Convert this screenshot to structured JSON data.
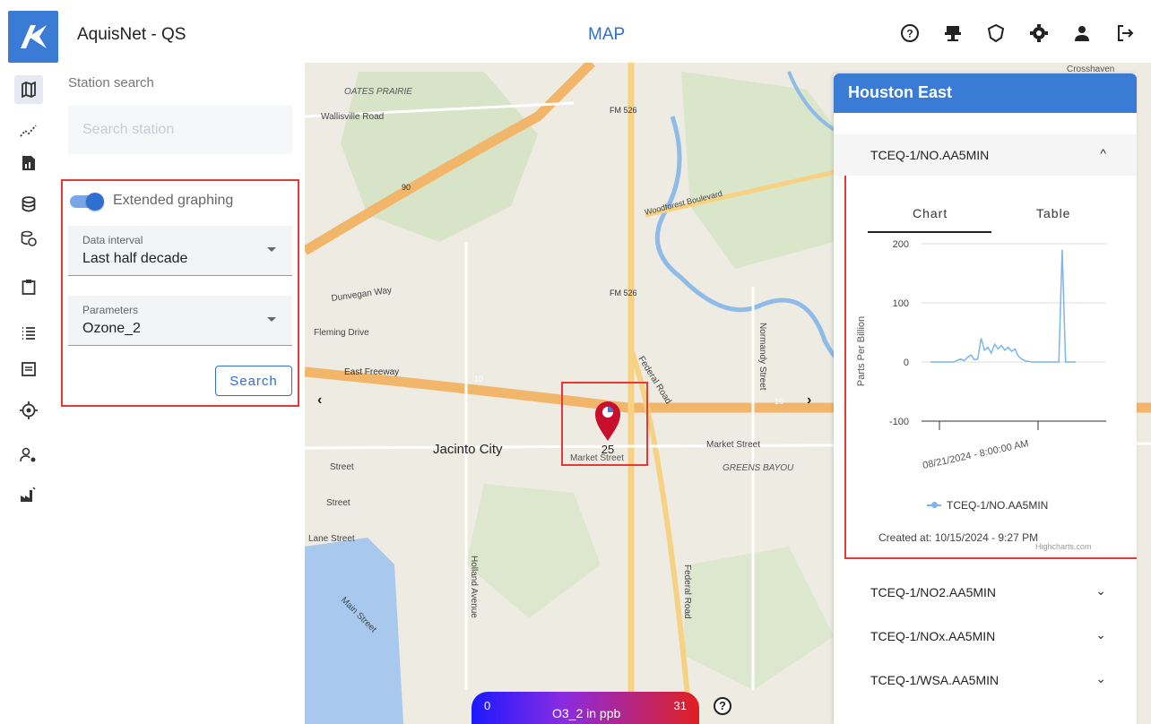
{
  "app": {
    "title": "AquisNet - QS",
    "page": "MAP"
  },
  "top_icons": [
    "help-icon",
    "station-icon",
    "shield-icon",
    "settings-icon",
    "user-icon",
    "logout-icon"
  ],
  "rail": [
    "map-icon",
    "trend-icon",
    "report-icon",
    "database-icon",
    "database-history-icon",
    "clipboard-icon",
    "list-icon",
    "document-icon",
    "target-icon",
    "user-settings-icon",
    "factory-icon"
  ],
  "left": {
    "search_label": "Station search",
    "search_placeholder": "Search station",
    "toggle_label": "Extended graphing",
    "toggle_on": true,
    "interval": {
      "label": "Data interval",
      "value": "Last half decade"
    },
    "params": {
      "label": "Parameters",
      "value": "Ozone_2"
    },
    "search_button": "Search"
  },
  "map": {
    "labels": {
      "oates": "OATES PRAIRIE",
      "wallisville": "Wallisville Road",
      "fm1": "FM 526",
      "fm2": "FM 526",
      "us90": "90",
      "woodforest": "Woodforest Boulevard",
      "dunvegan": "Dunvegan Way",
      "fleming": "Fleming Drive",
      "eastfwy": "East Freeway",
      "i10a": "10",
      "i10b": "10",
      "federal": "Federal Road",
      "normandy": "Normandy Street",
      "jacinto": "Jacinto City",
      "market": "Market Street",
      "market2": "Market Street",
      "greens": "GREENS BAYOU",
      "holland": "Holland Avenue",
      "mainst": "Main Street",
      "federal2": "Federal Road",
      "crosshaven": "Crosshaven",
      "street1": "Street",
      "street2": "Street",
      "lane": "Lane Street"
    },
    "marker_value": "25"
  },
  "panel": {
    "station": "Houston East",
    "items": [
      {
        "label": "TCEQ-1/NO.AA5MIN",
        "chevron": "^"
      },
      {
        "label": "TCEQ-1/NO2.AA5MIN",
        "chevron": "⌄"
      },
      {
        "label": "TCEQ-1/NOx.AA5MIN",
        "chevron": "⌄"
      },
      {
        "label": "TCEQ-1/WSA.AA5MIN",
        "chevron": "⌄"
      }
    ],
    "tabs": {
      "chart": "Chart",
      "table": "Table"
    },
    "created": "Created at: 10/15/2024 - 9:27 PM",
    "credit": "Highcharts.com"
  },
  "chart_data": {
    "type": "line",
    "ylabel": "Parts Per Billion",
    "ylim": [
      -100,
      200
    ],
    "yticks": [
      200,
      100,
      0,
      -100
    ],
    "xtick_label": "08/21/2024 - 8:00:00 AM",
    "series": [
      {
        "name": "TCEQ-1/NO.AA5MIN",
        "values": [
          0,
          0,
          0,
          0,
          0,
          0,
          0,
          0,
          3,
          5,
          2,
          8,
          12,
          4,
          5,
          40,
          20,
          25,
          15,
          30,
          22,
          28,
          20,
          25,
          18,
          22,
          10,
          5,
          2,
          1,
          0,
          0,
          0,
          0,
          0,
          0,
          0,
          0,
          0,
          190,
          0,
          0,
          0,
          0
        ]
      }
    ]
  },
  "colorbar": {
    "min": "0",
    "max": "31",
    "label": "O3_2 in ppb"
  }
}
